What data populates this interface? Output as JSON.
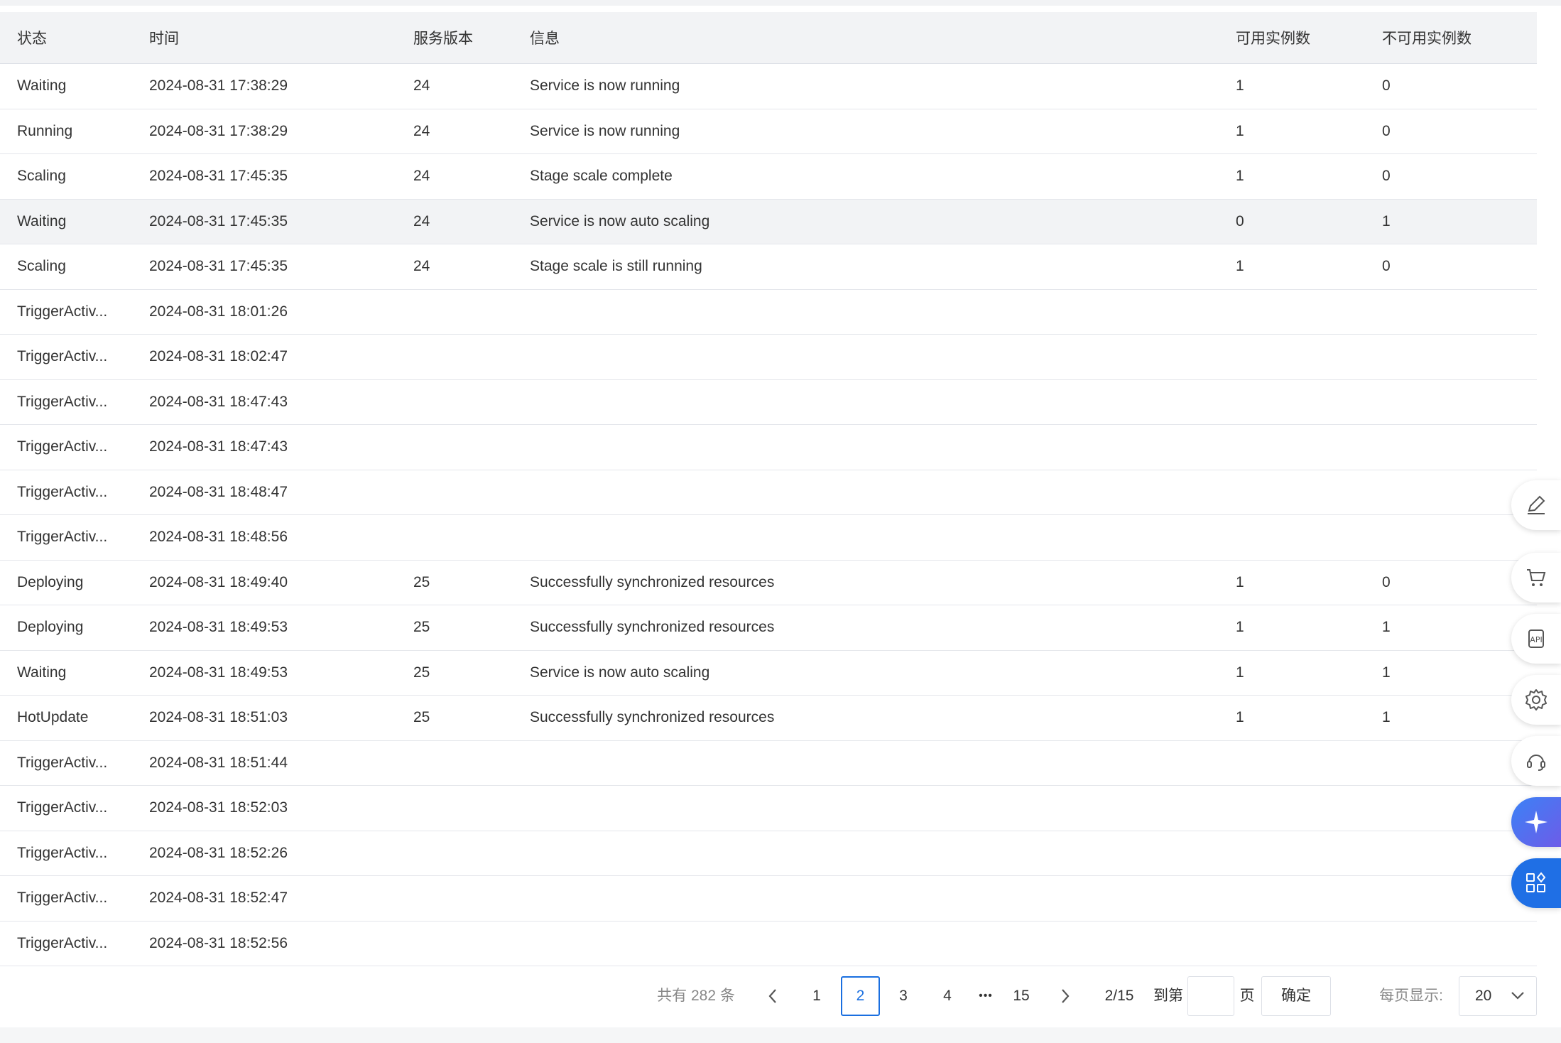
{
  "table": {
    "headers": {
      "status": "状态",
      "time": "时间",
      "version": "服务版本",
      "message": "信息",
      "available": "可用实例数",
      "unavailable": "不可用实例数"
    },
    "rows": [
      {
        "status": "Waiting",
        "time": "2024-08-31 17:38:29",
        "version": "24",
        "message": "Service is now running",
        "available": "1",
        "unavailable": "0"
      },
      {
        "status": "Running",
        "time": "2024-08-31 17:38:29",
        "version": "24",
        "message": "Service is now running",
        "available": "1",
        "unavailable": "0"
      },
      {
        "status": "Scaling",
        "time": "2024-08-31 17:45:35",
        "version": "24",
        "message": "Stage scale complete",
        "available": "1",
        "unavailable": "0"
      },
      {
        "status": "Waiting",
        "time": "2024-08-31 17:45:35",
        "version": "24",
        "message": "Service is now auto scaling",
        "available": "0",
        "unavailable": "1"
      },
      {
        "status": "Scaling",
        "time": "2024-08-31 17:45:35",
        "version": "24",
        "message": "Stage scale is still running",
        "available": "1",
        "unavailable": "0"
      },
      {
        "status": "TriggerActiv...",
        "time": "2024-08-31 18:01:26",
        "version": "",
        "message": "",
        "available": "",
        "unavailable": ""
      },
      {
        "status": "TriggerActiv...",
        "time": "2024-08-31 18:02:47",
        "version": "",
        "message": "",
        "available": "",
        "unavailable": ""
      },
      {
        "status": "TriggerActiv...",
        "time": "2024-08-31 18:47:43",
        "version": "",
        "message": "",
        "available": "",
        "unavailable": ""
      },
      {
        "status": "TriggerActiv...",
        "time": "2024-08-31 18:47:43",
        "version": "",
        "message": "",
        "available": "",
        "unavailable": ""
      },
      {
        "status": "TriggerActiv...",
        "time": "2024-08-31 18:48:47",
        "version": "",
        "message": "",
        "available": "",
        "unavailable": ""
      },
      {
        "status": "TriggerActiv...",
        "time": "2024-08-31 18:48:56",
        "version": "",
        "message": "",
        "available": "",
        "unavailable": ""
      },
      {
        "status": "Deploying",
        "time": "2024-08-31 18:49:40",
        "version": "25",
        "message": "Successfully synchronized resources",
        "available": "1",
        "unavailable": "0"
      },
      {
        "status": "Deploying",
        "time": "2024-08-31 18:49:53",
        "version": "25",
        "message": "Successfully synchronized resources",
        "available": "1",
        "unavailable": "1"
      },
      {
        "status": "Waiting",
        "time": "2024-08-31 18:49:53",
        "version": "25",
        "message": "Service is now auto scaling",
        "available": "1",
        "unavailable": "1"
      },
      {
        "status": "HotUpdate",
        "time": "2024-08-31 18:51:03",
        "version": "25",
        "message": "Successfully synchronized resources",
        "available": "1",
        "unavailable": "1"
      },
      {
        "status": "TriggerActiv...",
        "time": "2024-08-31 18:51:44",
        "version": "",
        "message": "",
        "available": "",
        "unavailable": ""
      },
      {
        "status": "TriggerActiv...",
        "time": "2024-08-31 18:52:03",
        "version": "",
        "message": "",
        "available": "",
        "unavailable": ""
      },
      {
        "status": "TriggerActiv...",
        "time": "2024-08-31 18:52:26",
        "version": "",
        "message": "",
        "available": "",
        "unavailable": ""
      },
      {
        "status": "TriggerActiv...",
        "time": "2024-08-31 18:52:47",
        "version": "",
        "message": "",
        "available": "",
        "unavailable": ""
      },
      {
        "status": "TriggerActiv...",
        "time": "2024-08-31 18:52:56",
        "version": "",
        "message": "",
        "available": "",
        "unavailable": ""
      }
    ]
  },
  "pagination": {
    "total_text": "共有 282 条",
    "pages": [
      "1",
      "2",
      "3",
      "4"
    ],
    "current_page": "2",
    "ellipsis": "•••",
    "last_page": "15",
    "page_indicator": "2/15",
    "goto_label": "到第",
    "goto_value": "",
    "page_suffix": "页",
    "confirm_label": "确定",
    "per_page_label": "每页显示:",
    "per_page_value": "20"
  },
  "float_toolbar": [
    {
      "icon": "edit-icon"
    },
    {
      "icon": "cart-icon"
    },
    {
      "icon": "api-icon"
    },
    {
      "icon": "gear-icon"
    },
    {
      "icon": "headset-icon"
    },
    {
      "icon": "ai-assistant-icon"
    },
    {
      "icon": "apps-grid-icon"
    }
  ],
  "colors": {
    "accent": "#1a6fe0",
    "header_bg": "#f2f3f5",
    "row_highlight": "#f2f3f5",
    "border": "#e4e6eb",
    "float_blue": "#1f6fe5"
  }
}
